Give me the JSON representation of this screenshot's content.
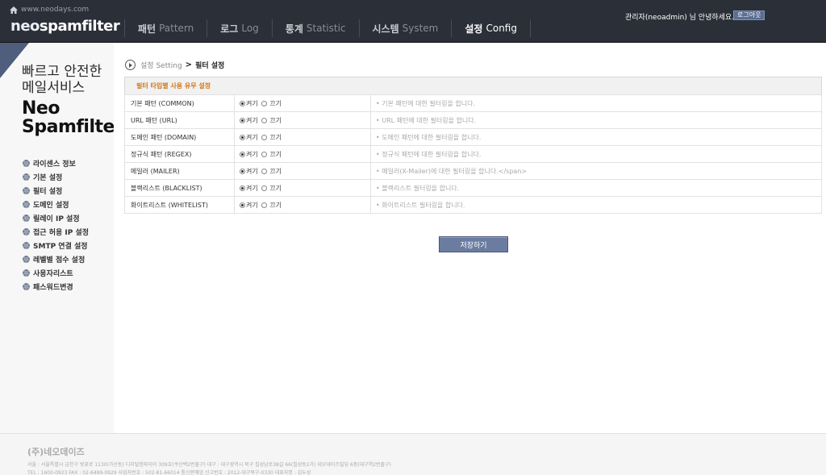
{
  "header": {
    "home_url_text": "www.neodays.com",
    "logo_neo": "neo",
    "logo_rest": "spamfilter",
    "nav": [
      {
        "ko": "패턴",
        "en": "Pattern"
      },
      {
        "ko": "로그",
        "en": "Log"
      },
      {
        "ko": "통계",
        "en": "Statistic"
      },
      {
        "ko": "시스템",
        "en": "System"
      },
      {
        "ko": "설정",
        "en": "Config"
      }
    ],
    "user_greeting": "관리자(neoadmin) 님 안녕하세요.",
    "logout_label": "로그아웃"
  },
  "sidebar": {
    "slogan_line1": "빠르고 안전한",
    "slogan_line2": "메일서비스",
    "brand_line1": "Neo",
    "brand_line2": "Spamfilter",
    "menu": [
      "라이센스 정보",
      "기본 설정",
      "필터 설정",
      "도메인 설정",
      "릴레이 IP 설정",
      "접근 허용 IP 설정",
      "SMTP 연결 설정",
      "레벨별 점수 설정",
      "사용자리스트",
      "패스워드변경"
    ]
  },
  "breadcrumb": {
    "parent_ko": "설정",
    "parent_en": "Setting",
    "separator": ">",
    "current": "필터 설정"
  },
  "table": {
    "header": "필터 타입별 사용 유무 설정",
    "on_label": "켜기",
    "off_label": "끄기",
    "rows": [
      {
        "name": "기본 패턴 (COMMON)",
        "desc": "• 기본 패턴에 대한 필터링을 합니다."
      },
      {
        "name": "URL 패턴 (URL)",
        "desc": "• URL 패턴에 대한 필터링을 합니다."
      },
      {
        "name": "도메인 패턴 (DOMAIN)",
        "desc": "• 도메인 패턴에 대한 필터링을 합니다."
      },
      {
        "name": "정규식 패턴 (REGEX)",
        "desc": "• 정규식 패턴에 대한 필터링을 합니다."
      },
      {
        "name": "메일러 (MAILER)",
        "desc": "• 메일러(X-Mailer)에 대한 필터링을 합니다.</span>"
      },
      {
        "name": "블랙리스트 (BLACKLIST)",
        "desc": "• 블랙리스트 필터링을 합니다."
      },
      {
        "name": "화이트리스트 (WHITELIST)",
        "desc": "• 화이트리스트 필터링을 합니다."
      }
    ]
  },
  "save_label": "저장하기",
  "footer": {
    "company": "(주)네오데이즈",
    "address": "서울 : 서울특별시 금천구 벚꽃로 1130(가산동) 디지털엠파이어 309호(쿠산백2번출구) 대구 : 대구광역시 북구 칠성남로38길 66(칠성동2가) 네오데이즈빌딩 6층(대구역2번출구)",
    "contact": "TEL : 1600-0923 FAX : 02-6499-0929 사업자번호 : 502-81-66014 통신판매업 신고번호 : 2012-대구북구-0330 대표자명 : 김두성"
  }
}
